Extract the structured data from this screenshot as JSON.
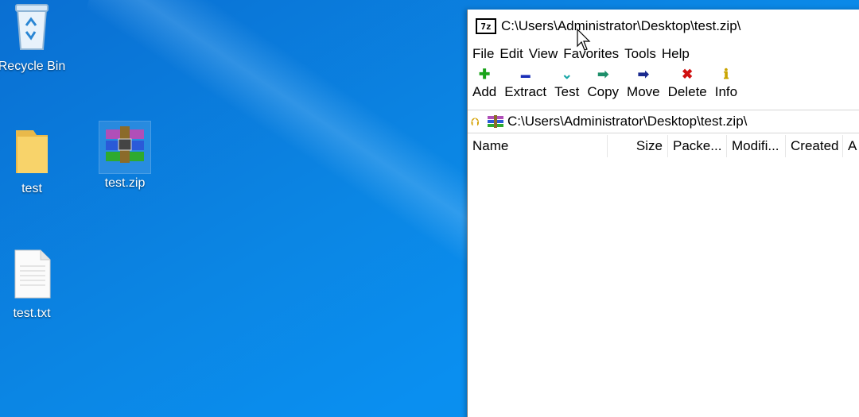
{
  "desktop": {
    "icons": [
      {
        "label": "Recycle Bin",
        "icon": "recycle-bin-icon"
      },
      {
        "label": "test",
        "icon": "folder-icon"
      },
      {
        "label": "test.zip",
        "icon": "winrar-archive-icon"
      },
      {
        "label": "test.txt",
        "icon": "text-file-icon"
      }
    ]
  },
  "window": {
    "app_icon_text": "7z",
    "title": "C:\\Users\\Administrator\\Desktop\\test.zip\\",
    "menu": [
      "File",
      "Edit",
      "View",
      "Favorites",
      "Tools",
      "Help"
    ],
    "toolbar": [
      {
        "label": "Add",
        "icon": "plus-icon",
        "glyph": "✚",
        "color": "#1aa31a"
      },
      {
        "label": "Extract",
        "icon": "minus-icon",
        "glyph": "▬",
        "color": "#1a2fb8"
      },
      {
        "label": "Test",
        "icon": "checkmark-icon",
        "glyph": "⌄",
        "color": "#18a6a6"
      },
      {
        "label": "Copy",
        "icon": "copy-arrow-icon",
        "glyph": "➡",
        "color": "#1e8f6a"
      },
      {
        "label": "Move",
        "icon": "move-arrow-icon",
        "glyph": "➡",
        "color": "#1a2a8f"
      },
      {
        "label": "Delete",
        "icon": "delete-x-icon",
        "glyph": "✖",
        "color": "#d01010"
      },
      {
        "label": "Info",
        "icon": "info-icon",
        "glyph": "ℹ",
        "color": "#c9a400"
      }
    ],
    "address": "C:\\Users\\Administrator\\Desktop\\test.zip\\",
    "columns": [
      "Name",
      "Size",
      "Packe...",
      "Modifi...",
      "Created",
      "A"
    ]
  }
}
